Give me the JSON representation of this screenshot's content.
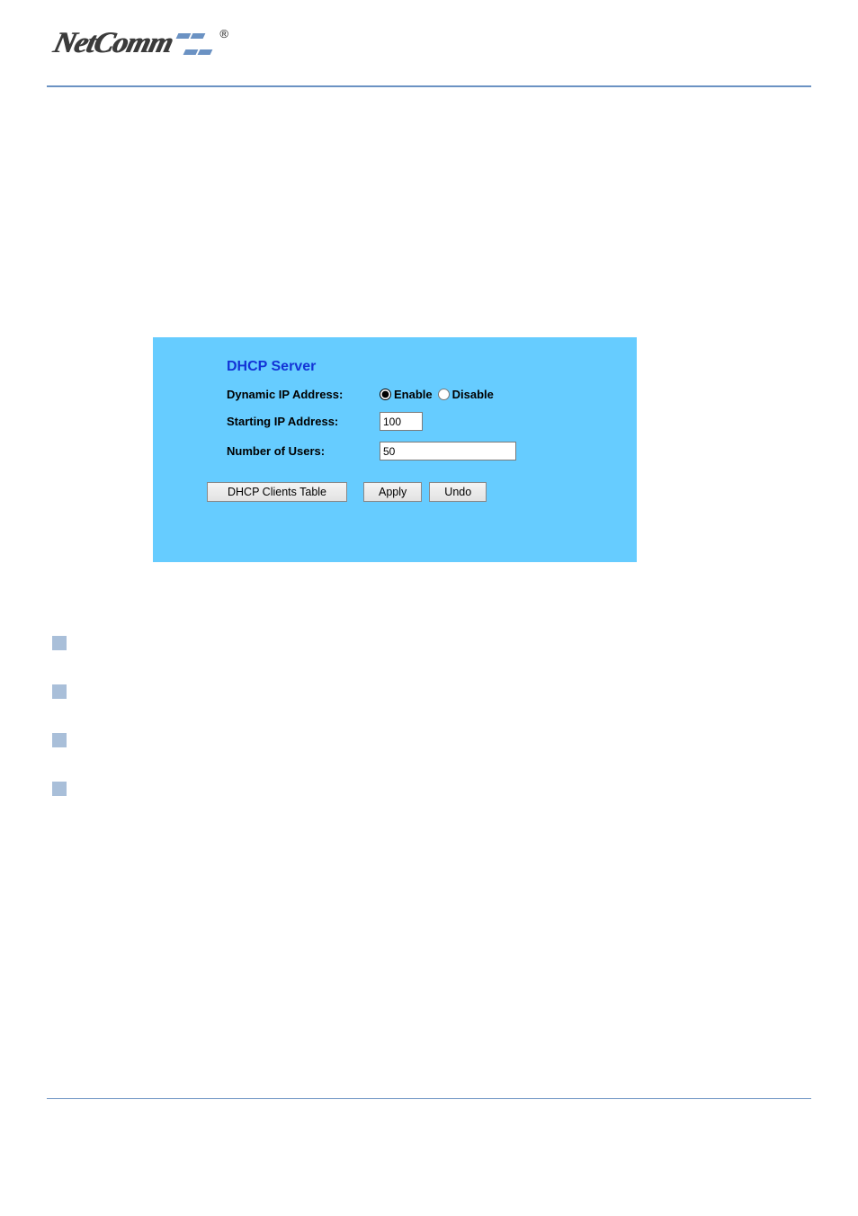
{
  "header": {
    "brand": "NetComm",
    "reg_symbol": "®"
  },
  "panel": {
    "title": "DHCP Server",
    "dynamic_ip_label": "Dynamic IP Address:",
    "enable_label": "Enable",
    "disable_label": "Disable",
    "dynamic_ip_selected": "enable",
    "starting_ip_label": "Starting IP Address:",
    "starting_ip_value": "100",
    "num_users_label": "Number of Users:",
    "num_users_value": "50",
    "btn_clients_table": "DHCP Clients Table",
    "btn_apply": "Apply",
    "btn_undo": "Undo"
  }
}
